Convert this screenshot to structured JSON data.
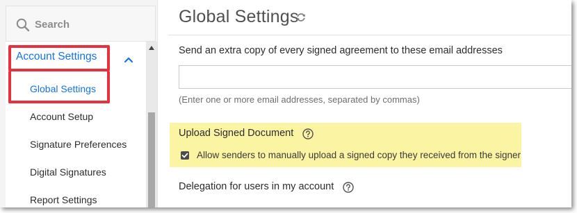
{
  "search": {
    "placeholder": "Search",
    "icon": "search-icon"
  },
  "sidebar": {
    "group": {
      "label": "Account Settings",
      "icon": "chevron-up-icon",
      "expanded": true
    },
    "items": [
      {
        "label": "Global Settings",
        "active": true
      },
      {
        "label": "Account Setup",
        "active": false
      },
      {
        "label": "Signature Preferences",
        "active": false
      },
      {
        "label": "Digital Signatures",
        "active": false
      },
      {
        "label": "Report Settings",
        "active": false
      }
    ]
  },
  "main": {
    "title": "Global Settings",
    "title_icon": "refresh-icon",
    "copy_section": {
      "label": "Send an extra copy of every signed agreement to these email addresses",
      "input_value": "",
      "hint": "(Enter one or more email addresses, separated by commas)"
    },
    "upload_section": {
      "title": "Upload Signed Document",
      "help_icon": "help-icon",
      "checkbox_checked": true,
      "checkbox_label": "Allow senders to manually upload a signed copy they received from the signer"
    },
    "delegation_section": {
      "title": "Delegation for users in my account",
      "help_icon": "help-icon"
    }
  },
  "colors": {
    "accent": "#1473e6",
    "callout": "#e8313d",
    "highlight": "#fbf5a3"
  }
}
